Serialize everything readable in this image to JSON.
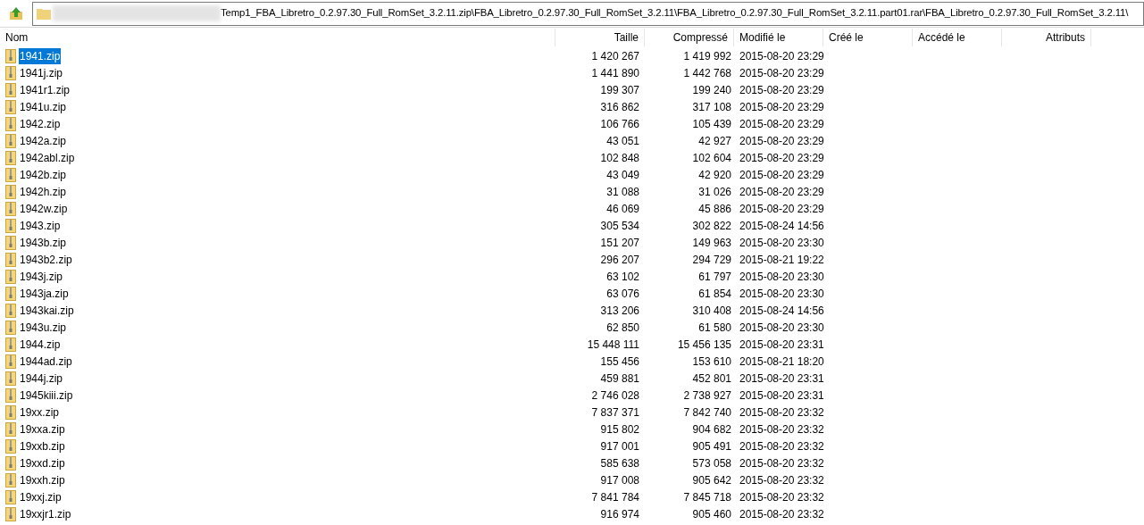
{
  "address_bar": {
    "path": "Temp1_FBA_Libretro_0.2.97.30_Full_RomSet_3.2.11.zip\\FBA_Libretro_0.2.97.30_Full_RomSet_3.2.11\\FBA_Libretro_0.2.97.30_Full_RomSet_3.2.11.part01.rar\\FBA_Libretro_0.2.97.30_Full_RomSet_3.2.11\\"
  },
  "table": {
    "columns": [
      "Nom",
      "Taille",
      "Compressé",
      "Modifié le",
      "Créé le",
      "Accédé le",
      "Attributs"
    ],
    "rows": [
      {
        "name": "1941.zip",
        "size": "1 420 267",
        "packed": "1 419 992",
        "modified": "2015-08-20 23:29",
        "selected": true
      },
      {
        "name": "1941j.zip",
        "size": "1 441 890",
        "packed": "1 442 768",
        "modified": "2015-08-20 23:29",
        "selected": false
      },
      {
        "name": "1941r1.zip",
        "size": "199 307",
        "packed": "199 240",
        "modified": "2015-08-20 23:29",
        "selected": false
      },
      {
        "name": "1941u.zip",
        "size": "316 862",
        "packed": "317 108",
        "modified": "2015-08-20 23:29",
        "selected": false
      },
      {
        "name": "1942.zip",
        "size": "106 766",
        "packed": "105 439",
        "modified": "2015-08-20 23:29",
        "selected": false
      },
      {
        "name": "1942a.zip",
        "size": "43 051",
        "packed": "42 927",
        "modified": "2015-08-20 23:29",
        "selected": false
      },
      {
        "name": "1942abl.zip",
        "size": "102 848",
        "packed": "102 604",
        "modified": "2015-08-20 23:29",
        "selected": false
      },
      {
        "name": "1942b.zip",
        "size": "43 049",
        "packed": "42 920",
        "modified": "2015-08-20 23:29",
        "selected": false
      },
      {
        "name": "1942h.zip",
        "size": "31 088",
        "packed": "31 026",
        "modified": "2015-08-20 23:29",
        "selected": false
      },
      {
        "name": "1942w.zip",
        "size": "46 069",
        "packed": "45 886",
        "modified": "2015-08-20 23:29",
        "selected": false
      },
      {
        "name": "1943.zip",
        "size": "305 534",
        "packed": "302 822",
        "modified": "2015-08-24 14:56",
        "selected": false
      },
      {
        "name": "1943b.zip",
        "size": "151 207",
        "packed": "149 963",
        "modified": "2015-08-20 23:30",
        "selected": false
      },
      {
        "name": "1943b2.zip",
        "size": "296 207",
        "packed": "294 729",
        "modified": "2015-08-21 19:22",
        "selected": false
      },
      {
        "name": "1943j.zip",
        "size": "63 102",
        "packed": "61 797",
        "modified": "2015-08-20 23:30",
        "selected": false
      },
      {
        "name": "1943ja.zip",
        "size": "63 076",
        "packed": "61 854",
        "modified": "2015-08-20 23:30",
        "selected": false
      },
      {
        "name": "1943kai.zip",
        "size": "313 206",
        "packed": "310 408",
        "modified": "2015-08-24 14:56",
        "selected": false
      },
      {
        "name": "1943u.zip",
        "size": "62 850",
        "packed": "61 580",
        "modified": "2015-08-20 23:30",
        "selected": false
      },
      {
        "name": "1944.zip",
        "size": "15 448 111",
        "packed": "15 456 135",
        "modified": "2015-08-20 23:31",
        "selected": false
      },
      {
        "name": "1944ad.zip",
        "size": "155 456",
        "packed": "153 610",
        "modified": "2015-08-21 18:20",
        "selected": false
      },
      {
        "name": "1944j.zip",
        "size": "459 881",
        "packed": "452 801",
        "modified": "2015-08-20 23:31",
        "selected": false
      },
      {
        "name": "1945kiii.zip",
        "size": "2 746 028",
        "packed": "2 738 927",
        "modified": "2015-08-20 23:31",
        "selected": false
      },
      {
        "name": "19xx.zip",
        "size": "7 837 371",
        "packed": "7 842 740",
        "modified": "2015-08-20 23:32",
        "selected": false
      },
      {
        "name": "19xxa.zip",
        "size": "915 802",
        "packed": "904 682",
        "modified": "2015-08-20 23:32",
        "selected": false
      },
      {
        "name": "19xxb.zip",
        "size": "917 001",
        "packed": "905 491",
        "modified": "2015-08-20 23:32",
        "selected": false
      },
      {
        "name": "19xxd.zip",
        "size": "585 638",
        "packed": "573 058",
        "modified": "2015-08-20 23:32",
        "selected": false
      },
      {
        "name": "19xxh.zip",
        "size": "917 008",
        "packed": "905 642",
        "modified": "2015-08-20 23:32",
        "selected": false
      },
      {
        "name": "19xxj.zip",
        "size": "7 841 784",
        "packed": "7 845 718",
        "modified": "2015-08-20 23:32",
        "selected": false
      },
      {
        "name": "19xxjr1.zip",
        "size": "916 974",
        "packed": "905 460",
        "modified": "2015-08-20 23:32",
        "selected": false
      }
    ]
  }
}
